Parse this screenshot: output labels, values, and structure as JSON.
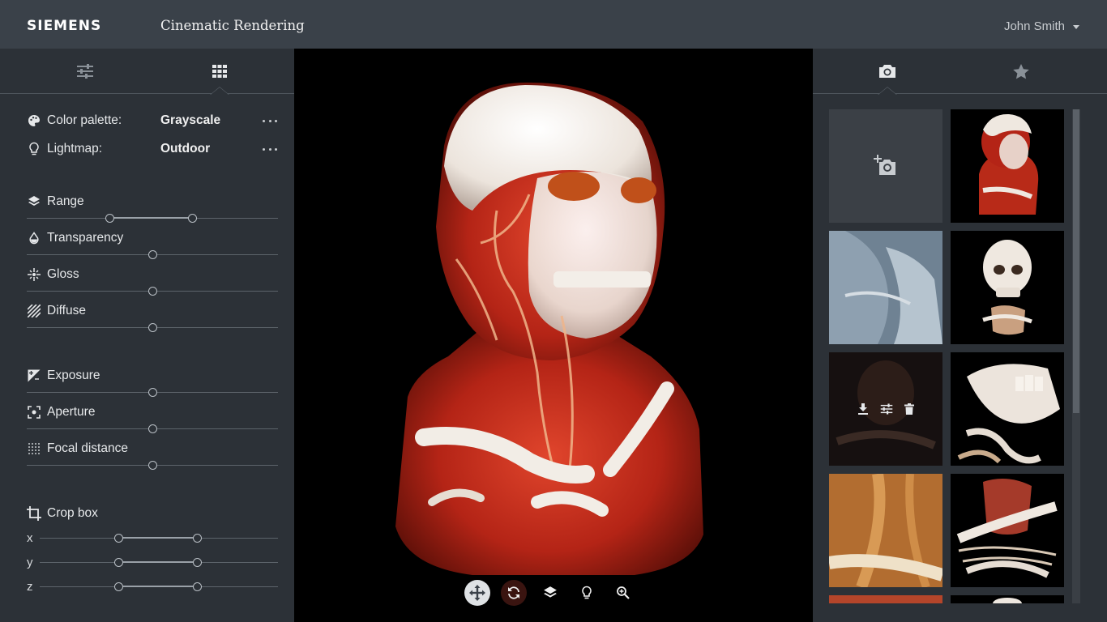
{
  "header": {
    "brand": "SIEMENS",
    "title": "Cinematic Rendering",
    "user": "John Smith"
  },
  "left_panel": {
    "tabs": [
      {
        "icon": "sliders-icon",
        "active": false
      },
      {
        "icon": "grid-icon",
        "active": true
      }
    ],
    "color_palette": {
      "label": "Color palette:",
      "value": "Grayscale"
    },
    "lightmap": {
      "label": "Lightmap:",
      "value": "Outdoor"
    },
    "range": {
      "label": "Range",
      "low": 0.33,
      "high": 0.66
    },
    "transparency": {
      "label": "Transparency",
      "value": 0.5
    },
    "gloss": {
      "label": "Gloss",
      "value": 0.5
    },
    "diffuse": {
      "label": "Diffuse",
      "value": 0.5
    },
    "exposure": {
      "label": "Exposure",
      "value": 0.5
    },
    "aperture": {
      "label": "Aperture",
      "value": 0.5
    },
    "focal_distance": {
      "label": "Focal distance",
      "value": 0.5
    },
    "crop_box": {
      "label": "Crop box",
      "axes": [
        {
          "label": "x",
          "low": 0.33,
          "high": 0.66
        },
        {
          "label": "y",
          "low": 0.33,
          "high": 0.66
        },
        {
          "label": "z",
          "low": 0.33,
          "high": 0.66
        }
      ]
    }
  },
  "viewport": {
    "tools": [
      "move-icon",
      "rotate-icon",
      "layers-icon",
      "lightbulb-icon",
      "zoom-icon"
    ],
    "active_tool": "move-icon"
  },
  "right_panel": {
    "tabs": [
      {
        "icon": "camera-icon",
        "active": true
      },
      {
        "icon": "star-icon",
        "active": false
      }
    ],
    "add_snapshot_icon": "add-camera-icon",
    "hover_actions": [
      "download-icon",
      "sliders-icon",
      "trash-icon"
    ],
    "colors": {
      "accent": "#dfe2e5",
      "panel": "#2c3137",
      "header": "#3a4149"
    }
  }
}
